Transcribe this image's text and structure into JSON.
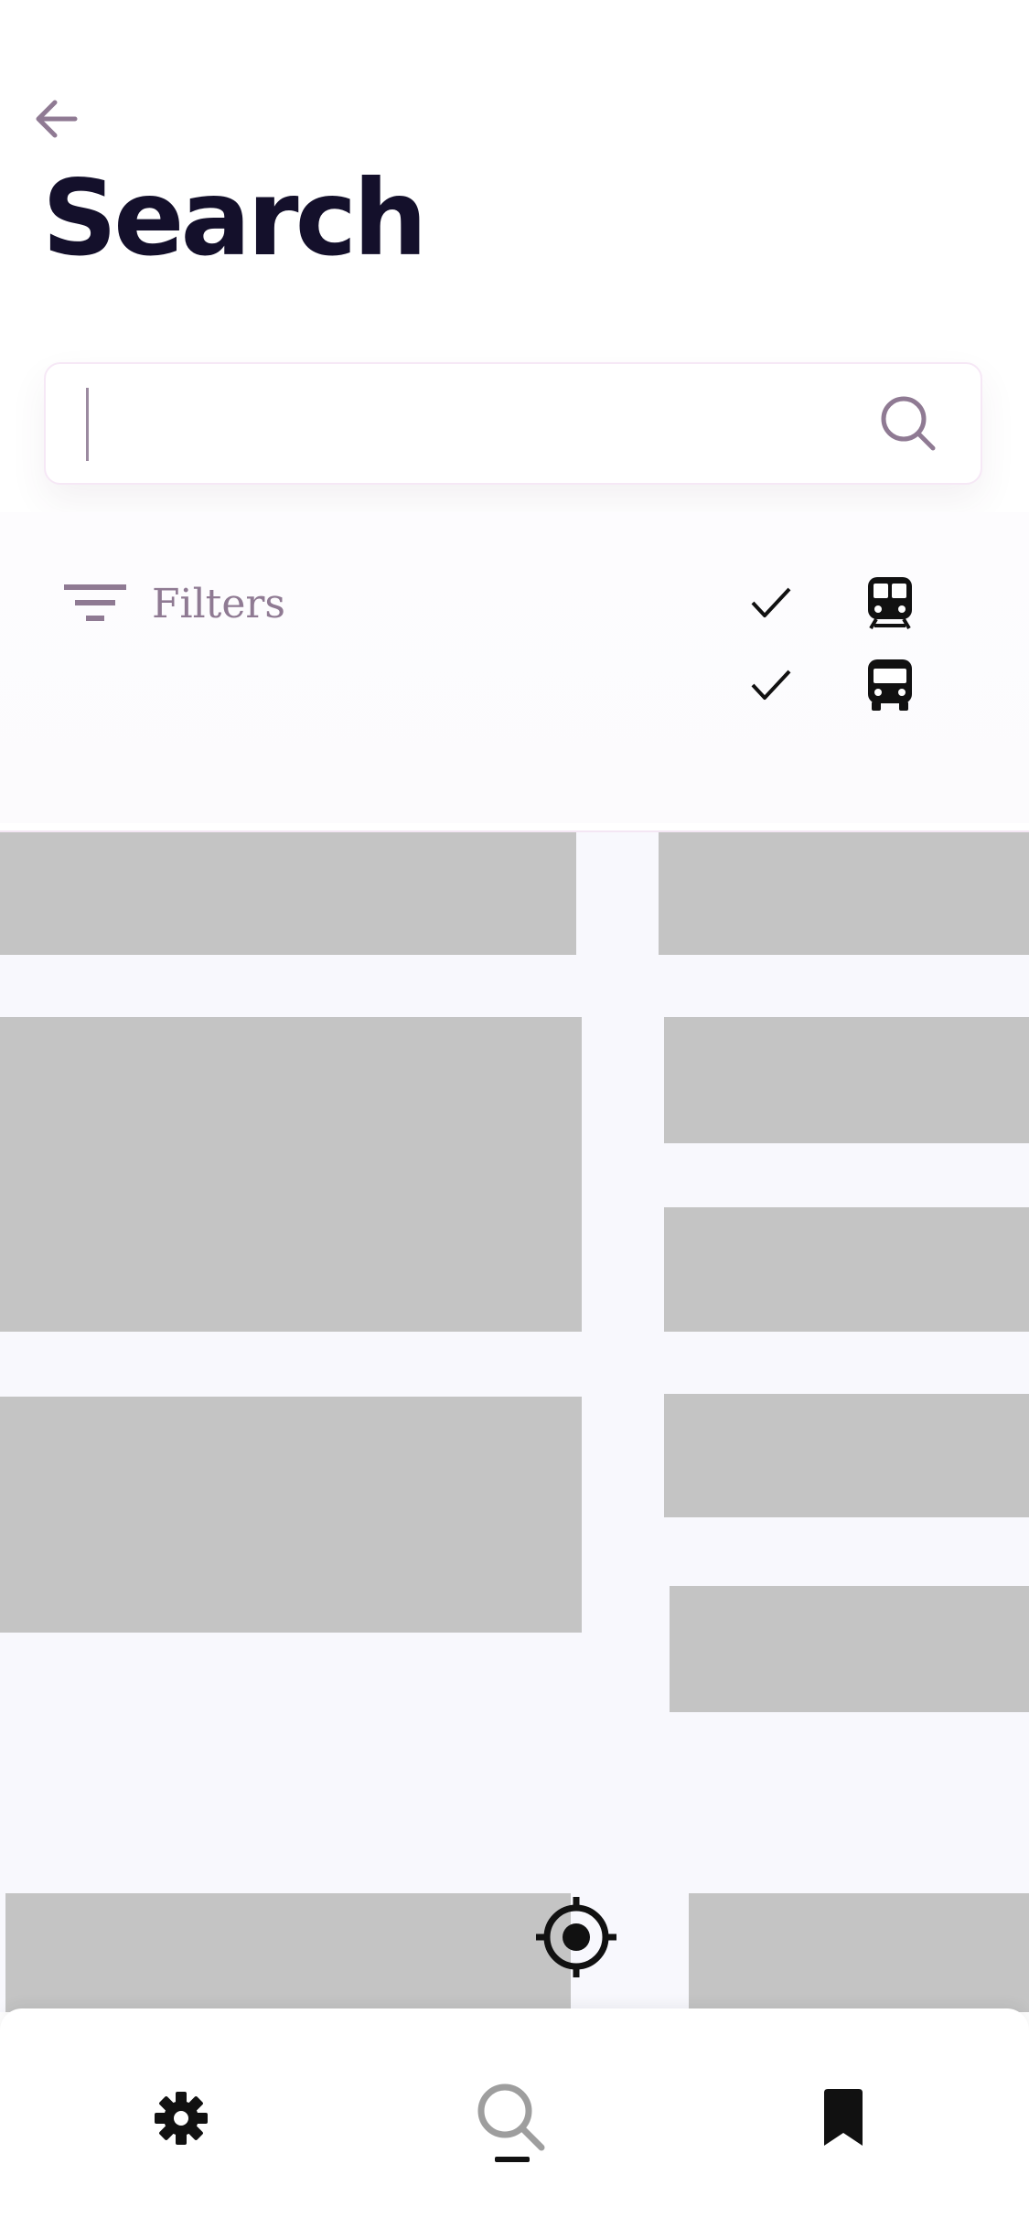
{
  "header": {
    "back_icon": "arrow-left-icon",
    "title": "Search"
  },
  "search": {
    "value": "",
    "placeholder": "",
    "icon": "search-icon"
  },
  "filters": {
    "label": "Filters",
    "icon": "filter-icon",
    "modes": [
      {
        "name": "train",
        "icon": "train-icon",
        "checked": true
      },
      {
        "name": "bus",
        "icon": "bus-icon",
        "checked": true
      }
    ]
  },
  "map": {
    "locate_icon": "crosshair-location-icon"
  },
  "bottom_nav": {
    "items": [
      {
        "name": "settings",
        "icon": "gear-icon",
        "active": false
      },
      {
        "name": "search",
        "icon": "search-icon",
        "active": true
      },
      {
        "name": "saved",
        "icon": "bookmark-icon",
        "active": false
      }
    ]
  },
  "colors": {
    "title": "#14102b",
    "accent": "#8f7a93",
    "map_background": "#f8f8fd",
    "map_block": "#c4c4c4"
  }
}
